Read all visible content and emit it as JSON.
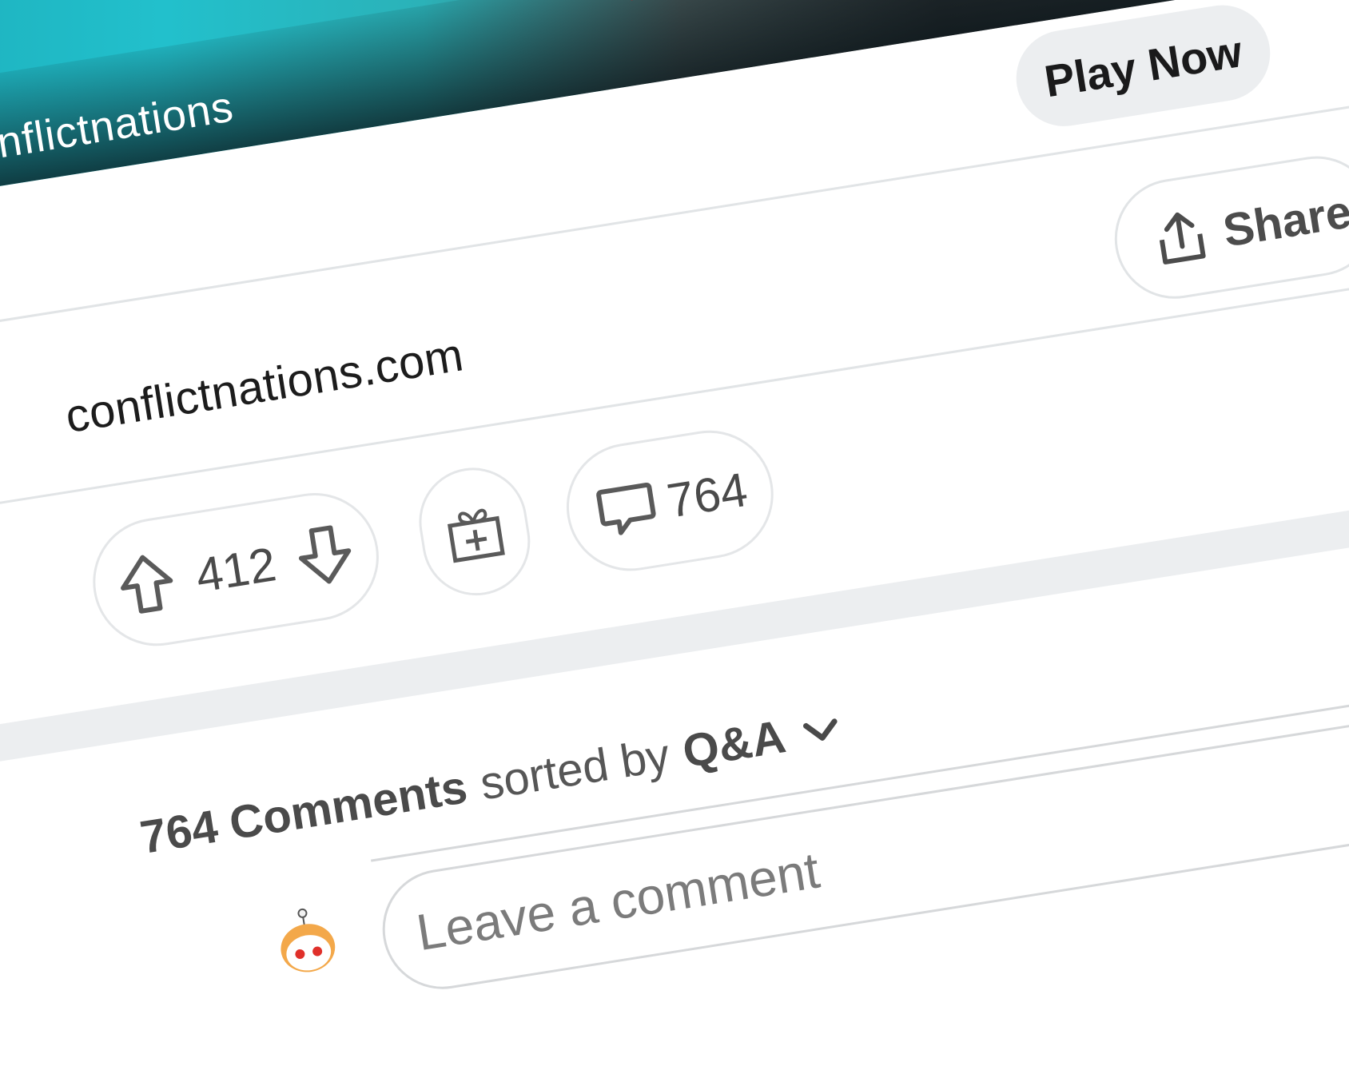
{
  "ad": {
    "advertiser": "conflictnations",
    "cta_label": "Play Now",
    "domain": "conflictnations.com"
  },
  "actions": {
    "upvote_icon": "arrow-up-outline-icon",
    "score": "412",
    "downvote_icon": "arrow-down-outline-icon",
    "award_icon": "gift-plus-icon",
    "comments_icon": "speech-bubble-icon",
    "comment_count": "764",
    "share_icon": "share-upload-icon",
    "share_label": "Share"
  },
  "comments": {
    "count_label": "764 Comments",
    "sorted_by_text": "sorted by",
    "sort_value": "Q&A",
    "input_placeholder": "Leave a comment"
  },
  "colors": {
    "pill_border": "#e4e6e8",
    "band": "#eceef0",
    "text": "#4a4a4a"
  }
}
